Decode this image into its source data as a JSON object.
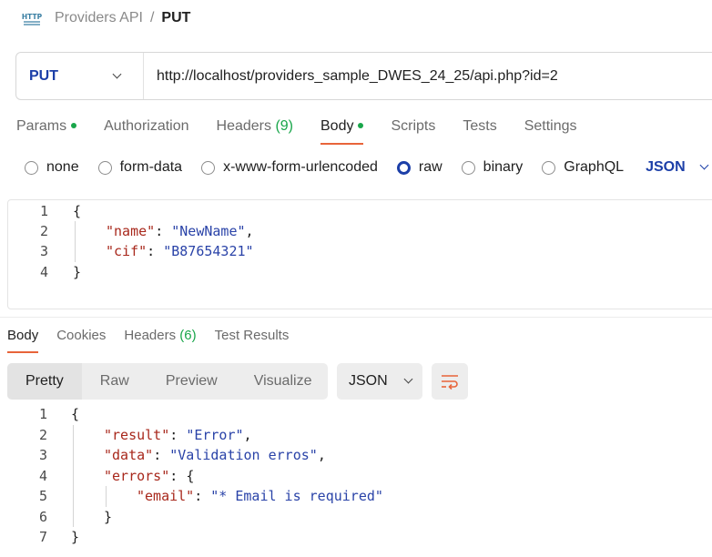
{
  "breadcrumb": {
    "parent": "Providers API",
    "separator": "/",
    "current": "PUT",
    "icon": "http-icon"
  },
  "request": {
    "method": "PUT",
    "url": "http://localhost/providers_sample_DWES_24_25/api.php?id=2"
  },
  "request_tabs": [
    {
      "label": "Params",
      "dot": true
    },
    {
      "label": "Authorization"
    },
    {
      "label": "Headers ",
      "count": "(9)"
    },
    {
      "label": "Body",
      "dot": true,
      "active": true
    },
    {
      "label": "Scripts"
    },
    {
      "label": "Tests"
    },
    {
      "label": "Settings"
    }
  ],
  "body_types": {
    "options": [
      "none",
      "form-data",
      "x-www-form-urlencoded",
      "raw",
      "binary",
      "GraphQL"
    ],
    "selected": "raw",
    "format": "JSON"
  },
  "request_body": {
    "line_numbers": [
      "1",
      "2",
      "3",
      "4"
    ],
    "open": "{",
    "close": "}",
    "fields": [
      {
        "key": "\"name\"",
        "value": "\"NewName\"",
        "sep": ": ",
        "trail": ","
      },
      {
        "key": "\"cif\"",
        "value": "\"B87654321\"",
        "sep": ": ",
        "trail": ""
      }
    ]
  },
  "response_tabs": [
    {
      "label": "Body",
      "active": true
    },
    {
      "label": "Cookies"
    },
    {
      "label": "Headers ",
      "count": "(6)"
    },
    {
      "label": "Test Results"
    }
  ],
  "view_modes": [
    "Pretty",
    "Raw",
    "Preview",
    "Visualize"
  ],
  "view_active": "Pretty",
  "response_format": "JSON",
  "response_body": {
    "line_numbers": [
      "1",
      "2",
      "3",
      "4",
      "5",
      "6",
      "7"
    ],
    "open": "{",
    "close": "}",
    "result_key": "\"result\"",
    "result_value": "\"Error\"",
    "data_key": "\"data\"",
    "data_value": "\"Validation erros\"",
    "errors_key": "\"errors\"",
    "errors_open": "{",
    "email_key": "\"email\"",
    "email_value": "\"* Email is required\"",
    "errors_close": "}"
  },
  "colors": {
    "accent": "#e8643a",
    "method": "#1c3fa8",
    "success": "#19a64a",
    "json_key": "#a8281c",
    "json_string": "#2a43a8"
  }
}
